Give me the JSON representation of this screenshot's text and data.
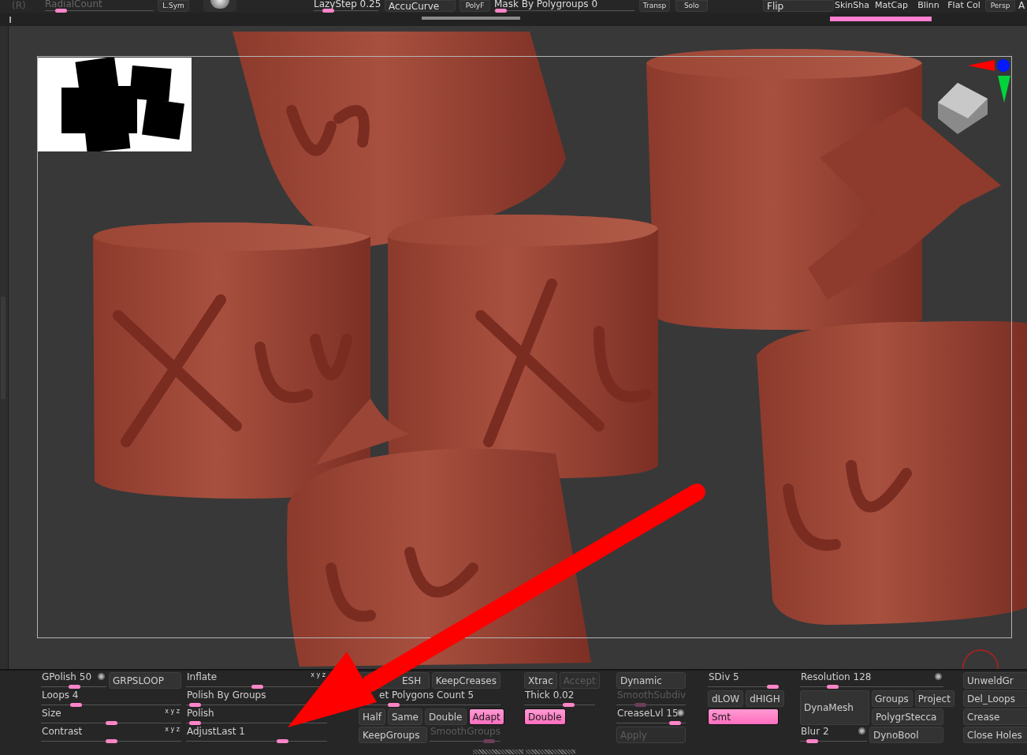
{
  "top_bar": {
    "items": [
      {
        "kind": "label",
        "label": "(R)",
        "disabled": true
      },
      {
        "kind": "slider",
        "label": "RadialCount",
        "level": 0.1,
        "disabled": true
      },
      {
        "kind": "mini_button",
        "label": "L.Sym"
      },
      {
        "kind": "sphere"
      },
      {
        "kind": "slider",
        "label": "LazyStep 0.25",
        "level": 0.15,
        "disabled": false
      },
      {
        "kind": "button",
        "label": "AccuCurve"
      },
      {
        "kind": "mini_button",
        "label": "PolyF"
      },
      {
        "kind": "slider",
        "label": "Mask By Polygroups 0",
        "level": 0.0,
        "disabled": false
      },
      {
        "kind": "mini_button",
        "label": "Transp"
      },
      {
        "kind": "mini_button",
        "label": "Solo"
      },
      {
        "kind": "button",
        "label": "Flip"
      },
      {
        "kind": "material",
        "label": "SkinSha"
      },
      {
        "kind": "material",
        "label": "MatCap"
      },
      {
        "kind": "material",
        "label": "Blinn"
      },
      {
        "kind": "material",
        "label": "Flat Col"
      },
      {
        "kind": "mini_button",
        "label": "Persp"
      },
      {
        "kind": "label",
        "label": "A",
        "disabled": false
      }
    ]
  },
  "bottom_panel": {
    "columns": [
      {
        "rows": [
          {
            "items": [
              {
                "kind": "slider",
                "label": "GPolish 50",
                "level": 0.5,
                "disabled": false,
                "toggle": true
              },
              {
                "kind": "button",
                "label": "GRPSLOOP",
                "on": false,
                "disabled": false
              }
            ]
          },
          {
            "items": [
              {
                "kind": "slider",
                "label": "Loops 4",
                "level": 0.22,
                "disabled": false
              }
            ]
          },
          {
            "items": [
              {
                "kind": "slider",
                "label": "Size",
                "level": 0.5,
                "disabled": false,
                "axes": "x y z"
              }
            ]
          },
          {
            "items": [
              {
                "kind": "slider",
                "label": "Contrast",
                "level": 0.5,
                "disabled": false,
                "axes": "x y z"
              }
            ]
          }
        ]
      },
      {
        "rows": [
          {
            "items": [
              {
                "kind": "slider",
                "label": "Inflate",
                "level": 0.5,
                "disabled": false,
                "axes": "x y z"
              }
            ]
          },
          {
            "items": [
              {
                "kind": "slider",
                "label": "Polish By Groups",
                "level": 0.02,
                "disabled": false
              }
            ]
          },
          {
            "items": [
              {
                "kind": "slider",
                "label": "Polish",
                "level": 0.02,
                "disabled": false
              }
            ]
          },
          {
            "items": [
              {
                "kind": "slider",
                "label": "AdjustLast 1",
                "level": 0.7,
                "disabled": false
              }
            ]
          }
        ]
      },
      {
        "rows": [
          {
            "items": [
              {
                "kind": "button",
                "label": "ESH",
                "on": false,
                "disabled": false
              },
              {
                "kind": "button",
                "label": "KeepCreases",
                "on": false,
                "disabled": false
              }
            ]
          },
          {
            "items": [
              {
                "kind": "slider",
                "label": "et Polygons Count 5",
                "level": 0.22,
                "disabled": false
              }
            ]
          },
          {
            "items": [
              {
                "kind": "button",
                "label": "Half",
                "on": false,
                "disabled": false
              },
              {
                "kind": "button",
                "label": "Same",
                "on": false,
                "disabled": false
              },
              {
                "kind": "button",
                "label": "Double",
                "on": false,
                "disabled": false
              },
              {
                "kind": "button",
                "label": "Adapt",
                "on": true,
                "disabled": false
              }
            ]
          },
          {
            "items": [
              {
                "kind": "button",
                "label": "KeepGroups",
                "on": false,
                "disabled": false
              },
              {
                "kind": "slider",
                "label": "SmoothGroups",
                "level": 0.9,
                "disabled": true
              }
            ]
          }
        ]
      },
      {
        "rows": [
          {
            "items": [
              {
                "kind": "button",
                "label": "Xtrac",
                "on": false,
                "disabled": false
              },
              {
                "kind": "button",
                "label": "Accept",
                "on": false,
                "disabled": true
              }
            ]
          },
          {
            "items": [
              {
                "kind": "slider",
                "label": "Thick 0.02",
                "level": 0.65,
                "disabled": false
              }
            ]
          },
          {
            "items": [
              {
                "kind": "button",
                "label": "Double",
                "on": true,
                "disabled": false
              }
            ]
          }
        ]
      },
      {
        "rows": [
          {
            "items": [
              {
                "kind": "button",
                "label": "Dynamic",
                "on": false,
                "disabled": false
              }
            ]
          },
          {
            "items": [
              {
                "kind": "slider",
                "label": "SmoothSubdiv",
                "level": 0.3,
                "disabled": true
              }
            ]
          },
          {
            "items": [
              {
                "kind": "slider",
                "label": "CreaseLvl 15",
                "level": 0.92,
                "disabled": false,
                "toggle": true
              }
            ]
          },
          {
            "items": [
              {
                "kind": "button",
                "label": "Apply",
                "on": false,
                "disabled": true
              }
            ]
          }
        ]
      },
      {
        "rows": [
          {
            "items": [
              {
                "kind": "slider",
                "label": "SDiv 5",
                "level": 1.0,
                "disabled": false
              }
            ]
          },
          {
            "items": [
              {
                "kind": "button",
                "label": "dLOW",
                "on": false,
                "disabled": false
              },
              {
                "kind": "button",
                "label": "dHIGH",
                "on": false,
                "disabled": false
              }
            ]
          },
          {
            "items": [
              {
                "kind": "button",
                "label": "Smt",
                "on": true,
                "disabled": false
              }
            ]
          }
        ]
      },
      {
        "rows": [
          {
            "items": [
              {
                "kind": "slider",
                "label": "Resolution 128",
                "level": 0.2,
                "disabled": false,
                "toggle": true
              }
            ]
          },
          {
            "items": [
              {
                "kind": "button",
                "label": "DynaMesh",
                "on": false,
                "disabled": false
              },
              {
                "kind": "button",
                "label": "Groups",
                "on": false,
                "disabled": false
              },
              {
                "kind": "button",
                "label": "Project",
                "on": false,
                "disabled": false
              }
            ]
          },
          {
            "items": [
              {
                "kind": "button",
                "label": "PolygrStecca",
                "on": false,
                "disabled": false
              }
            ]
          },
          {
            "items": [
              {
                "kind": "slider",
                "label": "Blur 2",
                "level": 0.1,
                "disabled": false,
                "toggle": true
              },
              {
                "kind": "button",
                "label": "DynoBool",
                "on": false,
                "disabled": false
              }
            ]
          }
        ]
      },
      {
        "rows": [
          {
            "items": [
              {
                "kind": "button",
                "label": "UnweldGr",
                "on": false,
                "disabled": false
              }
            ]
          },
          {
            "items": [
              {
                "kind": "button",
                "label": "Del_Loops",
                "on": false,
                "disabled": false
              }
            ]
          },
          {
            "items": [
              {
                "kind": "button",
                "label": "Crease",
                "on": false,
                "disabled": false
              }
            ]
          },
          {
            "items": [
              {
                "kind": "button",
                "label": "Close Holes",
                "on": false,
                "disabled": false
              }
            ]
          }
        ]
      }
    ]
  }
}
